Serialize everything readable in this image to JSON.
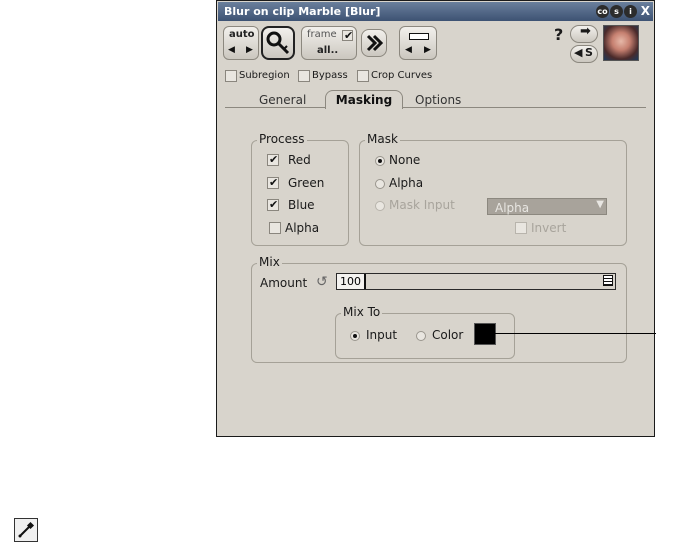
{
  "window": {
    "title": "Blur on clip Marble [Blur]"
  },
  "titlebar_icons": [
    "co",
    "s",
    "i"
  ],
  "titlebar_close": "X",
  "toolbar": {
    "auto_label": "auto",
    "frame_label": "frame",
    "frame_checked": true,
    "all_label": "all..",
    "help_label": "?",
    "cs_label": "S"
  },
  "options": [
    {
      "label": "Subregion",
      "checked": false
    },
    {
      "label": "Bypass",
      "checked": false
    },
    {
      "label": "Crop Curves",
      "checked": false
    }
  ],
  "tabs": [
    {
      "label": "General",
      "active": false
    },
    {
      "label": "Masking",
      "active": true
    },
    {
      "label": "Options",
      "active": false
    }
  ],
  "process": {
    "title": "Process",
    "items": [
      {
        "label": "Red",
        "checked": true
      },
      {
        "label": "Green",
        "checked": true
      },
      {
        "label": "Blue",
        "checked": true
      },
      {
        "label": "Alpha",
        "checked": false
      }
    ]
  },
  "mask": {
    "title": "Mask",
    "items": [
      {
        "label": "None",
        "selected": true,
        "enabled": true
      },
      {
        "label": "Alpha",
        "selected": false,
        "enabled": true
      },
      {
        "label": "Mask Input",
        "selected": false,
        "enabled": false
      }
    ],
    "dropdown_value": "Alpha",
    "invert_label": "Invert",
    "invert_checked": false
  },
  "mix": {
    "title": "Mix",
    "amount_label": "Amount",
    "amount_value": "100",
    "mix_to": {
      "title": "Mix To",
      "options": [
        {
          "label": "Input",
          "selected": true
        },
        {
          "label": "Color",
          "selected": false
        }
      ],
      "swatch_color": "#000000"
    }
  },
  "colors": {
    "titlebar": "#3d5273",
    "panel": "#d8d4cc",
    "slider_track": "#d8d4cc"
  }
}
